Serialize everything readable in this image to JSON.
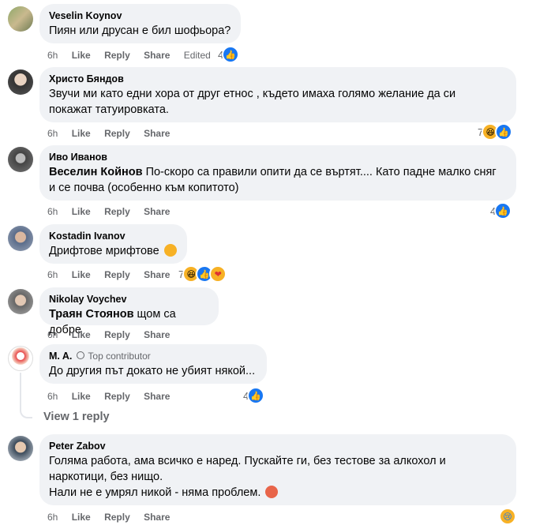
{
  "actions": {
    "like": "Like",
    "reply": "Reply",
    "share": "Share",
    "edited": "Edited"
  },
  "comments": [
    {
      "author": "Veselin Koynov",
      "text": "Пиян или друсан е бил шофьора?",
      "time": "6h",
      "edited": true,
      "reaction_count": "4",
      "reactions": [
        "like"
      ]
    },
    {
      "author": "Христо Бяндов",
      "text_line1": "Звучи ми като едни хора от друг етнос , където имаха голямо желание да си",
      "text_line2": "покажат татуировката.",
      "time": "6h",
      "reaction_count": "7",
      "reactions": [
        "haha",
        "like"
      ]
    },
    {
      "author": "Иво Иванов",
      "mention": "Веселин Койнов",
      "text_line1": " По-скоро са правили опити да се въртят.... Като падне малко сняг",
      "text_line2": "и се почва (особенно към копитото)",
      "time": "6h",
      "reaction_count": "4",
      "reactions": [
        "like"
      ]
    },
    {
      "author": "Kostadin Ivanov",
      "text": "Дрифтове мрифтове",
      "text_emoji": "haha",
      "time": "6h",
      "reaction_count": "7",
      "reactions": [
        "haha",
        "like",
        "care"
      ]
    },
    {
      "author": "Nikolay Voychev",
      "mention": "Траян Стоянов",
      "text": " щом са добре",
      "time": "6h",
      "reaction_count": "",
      "reactions": []
    },
    {
      "author": "M. A.",
      "badge": "Top contributor",
      "text": "До другия път докато не убият някой...",
      "time": "6h",
      "reaction_count": "4",
      "reactions": [
        "like"
      ]
    },
    {
      "author": "Peter Zabov",
      "text_line1": "Голяма работа, ама всичко е наред. Пускайте ги, без тестове за алкохол и",
      "text_line2": "наркотици, без нищо.",
      "text_line3": "Нали не е умрял никой - няма проблем.",
      "text_emoji": "angry",
      "time": "6h",
      "reaction_count": "",
      "reactions": [
        "sad"
      ]
    }
  ],
  "view_replies": "View 1 reply"
}
